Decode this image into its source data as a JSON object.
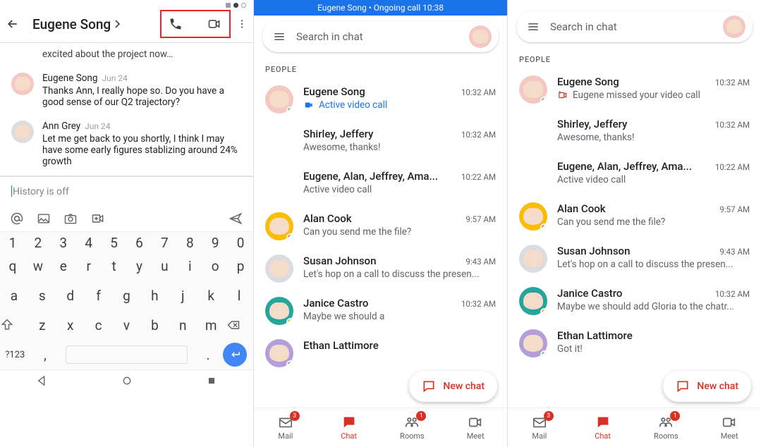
{
  "phoneA": {
    "header": {
      "title": "Eugene Song"
    },
    "cut_message": "excited about the project now…",
    "messages": [
      {
        "who": "Eugene Song",
        "when": "Jun 24",
        "text": "Thanks Ann, I really hope so. Do you have a good sense of our Q2 trajectory?"
      },
      {
        "who": "Ann Grey",
        "when": "Jun 24",
        "text": "Let me get back to you shortly, I think I may have some early figures stablizing around 24% growth"
      }
    ],
    "compose": {
      "history": "History is off",
      "sym": "?123"
    },
    "keyboard": {
      "numbers": [
        "1",
        "2",
        "3",
        "4",
        "5",
        "6",
        "7",
        "8",
        "9",
        "0"
      ],
      "row1": [
        "q",
        "w",
        "e",
        "r",
        "t",
        "y",
        "u",
        "i",
        "o",
        "p"
      ],
      "row2": [
        "a",
        "s",
        "d",
        "f",
        "g",
        "h",
        "j",
        "k",
        "l"
      ],
      "row3": [
        "z",
        "x",
        "c",
        "v",
        "b",
        "n",
        "m"
      ]
    }
  },
  "phoneB": {
    "topbar": "Eugene Song • Ongoing call 10:38",
    "search_ph": "Search in chat",
    "section": "PEOPLE",
    "chats": [
      {
        "name": "Eugene Song",
        "time": "10:32 AM",
        "snippet": "Active video call",
        "kind": "video-blue",
        "avatar": "pink",
        "badge": "green"
      },
      {
        "name": "Shirley, Jeffery",
        "time": "10:32 AM",
        "snippet": "Awesome, thanks!",
        "kind": "plain",
        "avatar": "group"
      },
      {
        "name": "Eugene, Alan, Jeffrey, Ama...",
        "time": "10:22 AM",
        "snippet": "Active video call",
        "kind": "plain",
        "avatar": "group"
      },
      {
        "name": "Alan Cook",
        "time": "9:57 AM",
        "snippet": "Can you send me the file?",
        "kind": "plain",
        "avatar": "yellow",
        "badge": "red"
      },
      {
        "name": "Susan Johnson",
        "time": "9:43 AM",
        "snippet": "Let's hop on a call to discuss the presen...",
        "kind": "plain",
        "avatar": "grey"
      },
      {
        "name": "Janice Castro",
        "time": "10:32 AM",
        "snippet": "Maybe we should a",
        "kind": "plain",
        "avatar": "teal",
        "badge": "amber"
      },
      {
        "name": "Ethan Lattimore",
        "time": "",
        "snippet": "",
        "kind": "plain",
        "avatar": "lav",
        "badge": "green"
      }
    ],
    "fab": "New chat",
    "nav": {
      "mail": "Mail",
      "mail_badge": "3",
      "chat": "Chat",
      "rooms": "Rooms",
      "rooms_badge": "1",
      "meet": "Meet"
    }
  },
  "phoneC": {
    "search_ph": "Search in chat",
    "section": "PEOPLE",
    "chats": [
      {
        "name": "Eugene Song",
        "time": "10:32 AM",
        "snippet": "Eugene missed your video call",
        "kind": "missed-red",
        "avatar": "pink",
        "badge": "green"
      },
      {
        "name": "Shirley, Jeffery",
        "time": "10:32 AM",
        "snippet": "Awesome, thanks!",
        "kind": "plain",
        "avatar": "group"
      },
      {
        "name": "Eugene, Alan, Jeffrey, Ama...",
        "time": "10:22 AM",
        "snippet": "Active video call",
        "kind": "plain",
        "avatar": "group"
      },
      {
        "name": "Alan Cook",
        "time": "9:57 AM",
        "snippet": "Can you send me the file?",
        "kind": "plain",
        "avatar": "yellow",
        "badge": "red"
      },
      {
        "name": "Susan Johnson",
        "time": "9:43 AM",
        "snippet": "Let's hop on a call to discuss the presen...",
        "kind": "plain",
        "avatar": "grey"
      },
      {
        "name": "Janice Castro",
        "time": "10:32 AM",
        "snippet": "Maybe we should add Gloria to the chatr...",
        "kind": "plain",
        "avatar": "teal",
        "badge": "amber"
      },
      {
        "name": "Ethan Lattimore",
        "time": "",
        "snippet": "Got it!",
        "kind": "plain",
        "avatar": "lav",
        "badge": "green"
      }
    ],
    "fab": "New chat",
    "nav": {
      "mail": "Mail",
      "mail_badge": "3",
      "chat": "Chat",
      "rooms": "Rooms",
      "rooms_badge": "1",
      "meet": "Meet"
    }
  },
  "avatar_colors": {
    "pink": "#f4c7c3",
    "yellow": "#fbbc04",
    "grey": "#dadce0",
    "teal": "#26a69a",
    "lav": "#b39ddb"
  }
}
